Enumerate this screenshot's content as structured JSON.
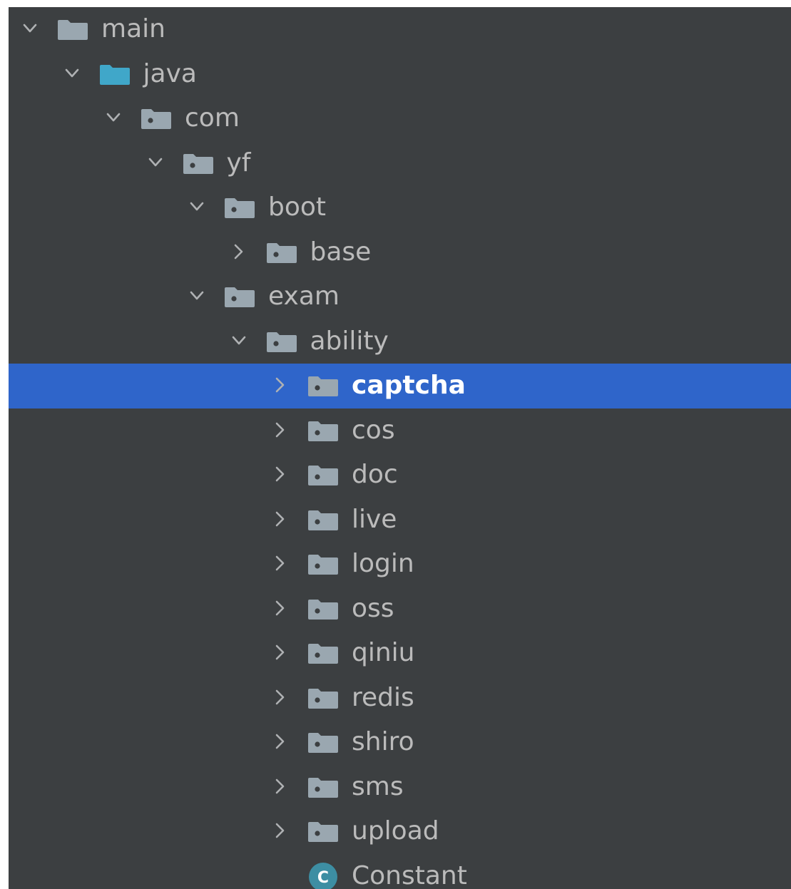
{
  "project_tree": {
    "selected_index": 8,
    "items": [
      {
        "label": "main",
        "depth": 0,
        "expanded": true,
        "kind": "folder",
        "icon": "folder-icon"
      },
      {
        "label": "java",
        "depth": 1,
        "expanded": true,
        "kind": "source-folder",
        "icon": "source-folder-icon"
      },
      {
        "label": "com",
        "depth": 2,
        "expanded": true,
        "kind": "package",
        "icon": "package-icon"
      },
      {
        "label": "yf",
        "depth": 3,
        "expanded": true,
        "kind": "package",
        "icon": "package-icon"
      },
      {
        "label": "boot",
        "depth": 4,
        "expanded": true,
        "kind": "package",
        "icon": "package-icon"
      },
      {
        "label": "base",
        "depth": 5,
        "expanded": false,
        "kind": "package",
        "icon": "package-icon"
      },
      {
        "label": "exam",
        "depth": 4,
        "expanded": true,
        "kind": "package",
        "icon": "package-icon"
      },
      {
        "label": "ability",
        "depth": 5,
        "expanded": true,
        "kind": "package",
        "icon": "package-icon"
      },
      {
        "label": "captcha",
        "depth": 6,
        "expanded": false,
        "kind": "package",
        "icon": "package-icon"
      },
      {
        "label": "cos",
        "depth": 6,
        "expanded": false,
        "kind": "package",
        "icon": "package-icon"
      },
      {
        "label": "doc",
        "depth": 6,
        "expanded": false,
        "kind": "package",
        "icon": "package-icon"
      },
      {
        "label": "live",
        "depth": 6,
        "expanded": false,
        "kind": "package",
        "icon": "package-icon"
      },
      {
        "label": "login",
        "depth": 6,
        "expanded": false,
        "kind": "package",
        "icon": "package-icon"
      },
      {
        "label": "oss",
        "depth": 6,
        "expanded": false,
        "kind": "package",
        "icon": "package-icon"
      },
      {
        "label": "qiniu",
        "depth": 6,
        "expanded": false,
        "kind": "package",
        "icon": "package-icon"
      },
      {
        "label": "redis",
        "depth": 6,
        "expanded": false,
        "kind": "package",
        "icon": "package-icon"
      },
      {
        "label": "shiro",
        "depth": 6,
        "expanded": false,
        "kind": "package",
        "icon": "package-icon"
      },
      {
        "label": "sms",
        "depth": 6,
        "expanded": false,
        "kind": "package",
        "icon": "package-icon"
      },
      {
        "label": "upload",
        "depth": 6,
        "expanded": false,
        "kind": "package",
        "icon": "package-icon"
      },
      {
        "label": "Constant",
        "depth": 6,
        "expanded": null,
        "kind": "class",
        "icon": "java-class-icon",
        "icon_letter": "C"
      }
    ]
  },
  "colors": {
    "panel_bg": "#3c3f41",
    "selection_bg": "#2f65ca",
    "text": "#bbbbbb",
    "text_selected": "#ffffff",
    "chevron": "#afb1b3",
    "folder": "#9aa7b0",
    "source_folder": "#40a7c9",
    "class_icon": "#3d8ea3"
  }
}
